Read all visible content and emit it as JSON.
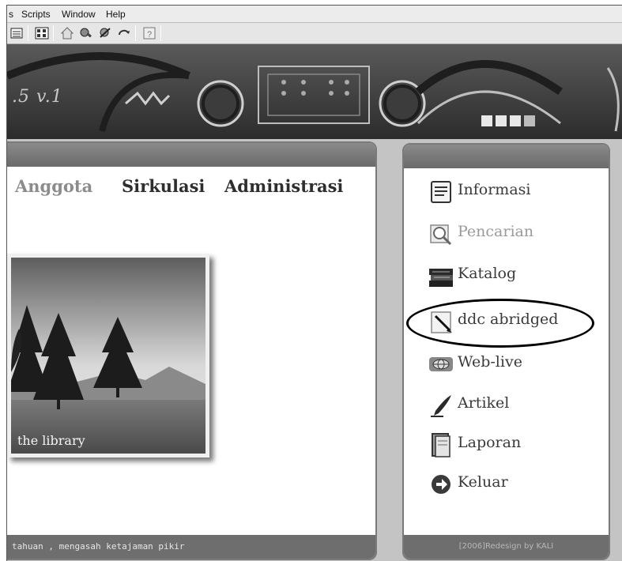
{
  "menu": {
    "items": [
      "s",
      "Scripts",
      "Window",
      "Help"
    ]
  },
  "toolbar": {
    "buttons": [
      "list-icon",
      "grid-icon",
      "home-icon",
      "tools-icon",
      "tools-alt-icon",
      "refresh-icon",
      "help-icon"
    ]
  },
  "banner": {
    "version": ".5 v.1"
  },
  "main": {
    "nav": [
      "Anggota",
      "Sirkulasi",
      "Administrasi"
    ],
    "photo_caption": "the library",
    "ticker": "tahuan ,  mengasah ketajaman pikir"
  },
  "side": {
    "items": [
      {
        "label": "Informasi",
        "icon": "document-icon"
      },
      {
        "label": "Pencarian",
        "icon": "search-icon"
      },
      {
        "label": "Katalog",
        "icon": "books-icon"
      },
      {
        "label": "ddc abridged",
        "icon": "pen-paper-icon"
      },
      {
        "label": "Web-live",
        "icon": "globe-icon"
      },
      {
        "label": "Artikel",
        "icon": "quill-icon"
      },
      {
        "label": "Laporan",
        "icon": "notebook-icon"
      },
      {
        "label": "Keluar",
        "icon": "exit-arrow-icon"
      }
    ],
    "credit": "[2006]Redesign by KALI"
  }
}
